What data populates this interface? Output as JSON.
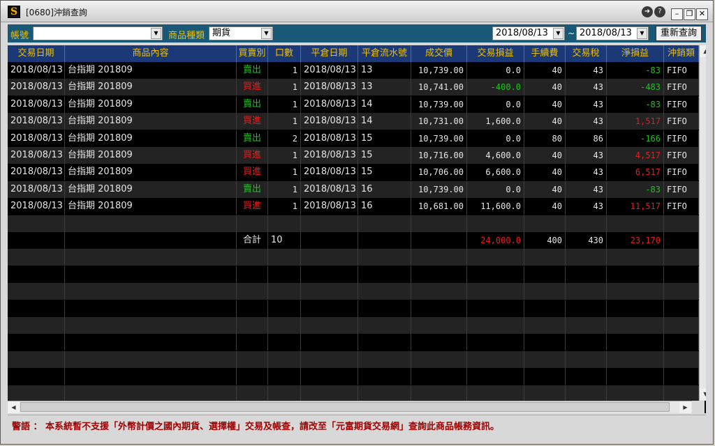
{
  "window": {
    "title": "[0680]沖銷查詢",
    "app_icon": "S"
  },
  "toolbar": {
    "account_label": "帳號",
    "account_value": "",
    "product_type_label": "商品種類",
    "product_type_value": "期貨",
    "date_from": "2018/08/13",
    "date_separator": "~",
    "date_to": "2018/08/13",
    "refresh_label": "重新查詢"
  },
  "columns": [
    "交易日期",
    "商品內容",
    "買賣別",
    "口數",
    "平倉日期",
    "平倉流水號",
    "成交價",
    "交易損益",
    "手續費",
    "交易稅",
    "淨損益",
    "沖銷類"
  ],
  "rows": [
    {
      "trade_date": "2018/08/13",
      "product": "台指期 201809",
      "side": "賣出",
      "side_color": "green",
      "qty": "1",
      "close_date": "2018/08/13",
      "close_serial": "13",
      "price": "10,739.00",
      "trade_pl": "0.0",
      "trade_pl_color": "white",
      "fee": "40",
      "tax": "43",
      "net_pl": "-83",
      "net_pl_color": "green",
      "offset": "FIFO"
    },
    {
      "trade_date": "2018/08/13",
      "product": "台指期 201809",
      "side": "買進",
      "side_color": "red",
      "qty": "1",
      "close_date": "2018/08/13",
      "close_serial": "13",
      "price": "10,741.00",
      "trade_pl": "-400.0",
      "trade_pl_color": "green",
      "fee": "40",
      "tax": "43",
      "net_pl": "-483",
      "net_pl_color": "green",
      "offset": "FIFO"
    },
    {
      "trade_date": "2018/08/13",
      "product": "台指期 201809",
      "side": "賣出",
      "side_color": "green",
      "qty": "1",
      "close_date": "2018/08/13",
      "close_serial": "14",
      "price": "10,739.00",
      "trade_pl": "0.0",
      "trade_pl_color": "white",
      "fee": "40",
      "tax": "43",
      "net_pl": "-83",
      "net_pl_color": "green",
      "offset": "FIFO"
    },
    {
      "trade_date": "2018/08/13",
      "product": "台指期 201809",
      "side": "買進",
      "side_color": "red",
      "qty": "1",
      "close_date": "2018/08/13",
      "close_serial": "14",
      "price": "10,731.00",
      "trade_pl": "1,600.0",
      "trade_pl_color": "white",
      "fee": "40",
      "tax": "43",
      "net_pl": "1,517",
      "net_pl_color": "red",
      "offset": "FIFO"
    },
    {
      "trade_date": "2018/08/13",
      "product": "台指期 201809",
      "side": "賣出",
      "side_color": "green",
      "qty": "2",
      "close_date": "2018/08/13",
      "close_serial": "15",
      "price": "10,739.00",
      "trade_pl": "0.0",
      "trade_pl_color": "white",
      "fee": "80",
      "tax": "86",
      "net_pl": "-166",
      "net_pl_color": "green",
      "offset": "FIFO"
    },
    {
      "trade_date": "2018/08/13",
      "product": "台指期 201809",
      "side": "買進",
      "side_color": "red",
      "qty": "1",
      "close_date": "2018/08/13",
      "close_serial": "15",
      "price": "10,716.00",
      "trade_pl": "4,600.0",
      "trade_pl_color": "white",
      "fee": "40",
      "tax": "43",
      "net_pl": "4,517",
      "net_pl_color": "red",
      "offset": "FIFO"
    },
    {
      "trade_date": "2018/08/13",
      "product": "台指期 201809",
      "side": "買進",
      "side_color": "red",
      "qty": "1",
      "close_date": "2018/08/13",
      "close_serial": "15",
      "price": "10,706.00",
      "trade_pl": "6,600.0",
      "trade_pl_color": "white",
      "fee": "40",
      "tax": "43",
      "net_pl": "6,517",
      "net_pl_color": "red",
      "offset": "FIFO"
    },
    {
      "trade_date": "2018/08/13",
      "product": "台指期 201809",
      "side": "賣出",
      "side_color": "green",
      "qty": "1",
      "close_date": "2018/08/13",
      "close_serial": "16",
      "price": "10,739.00",
      "trade_pl": "0.0",
      "trade_pl_color": "white",
      "fee": "40",
      "tax": "43",
      "net_pl": "-83",
      "net_pl_color": "green",
      "offset": "FIFO"
    },
    {
      "trade_date": "2018/08/13",
      "product": "台指期 201809",
      "side": "買進",
      "side_color": "red",
      "qty": "1",
      "close_date": "2018/08/13",
      "close_serial": "16",
      "price": "10,681.00",
      "trade_pl": "11,600.0",
      "trade_pl_color": "white",
      "fee": "40",
      "tax": "43",
      "net_pl": "11,517",
      "net_pl_color": "red",
      "offset": "FIFO"
    }
  ],
  "totals": {
    "label": "合計",
    "qty": "10",
    "trade_pl": "24,000.0",
    "fee": "400",
    "tax": "430",
    "net_pl": "23,170"
  },
  "warning": "警語 ： 本系統暫不支援「外幣計價之國內期貨、選擇權」交易及帳查，請改至「元富期貨交易網」查詢此商品帳務資訊。",
  "colors": {
    "header_bg": "#1b3877",
    "header_text": "#f0c000",
    "toolbar_bg": "#1a5878",
    "green": "#22c022",
    "red": "#e02020",
    "warning_text": "#a00000"
  },
  "icons": {
    "share": "share-icon",
    "help": "help-icon",
    "minimize": "minimize-icon",
    "restore": "restore-icon",
    "close": "close-icon"
  }
}
